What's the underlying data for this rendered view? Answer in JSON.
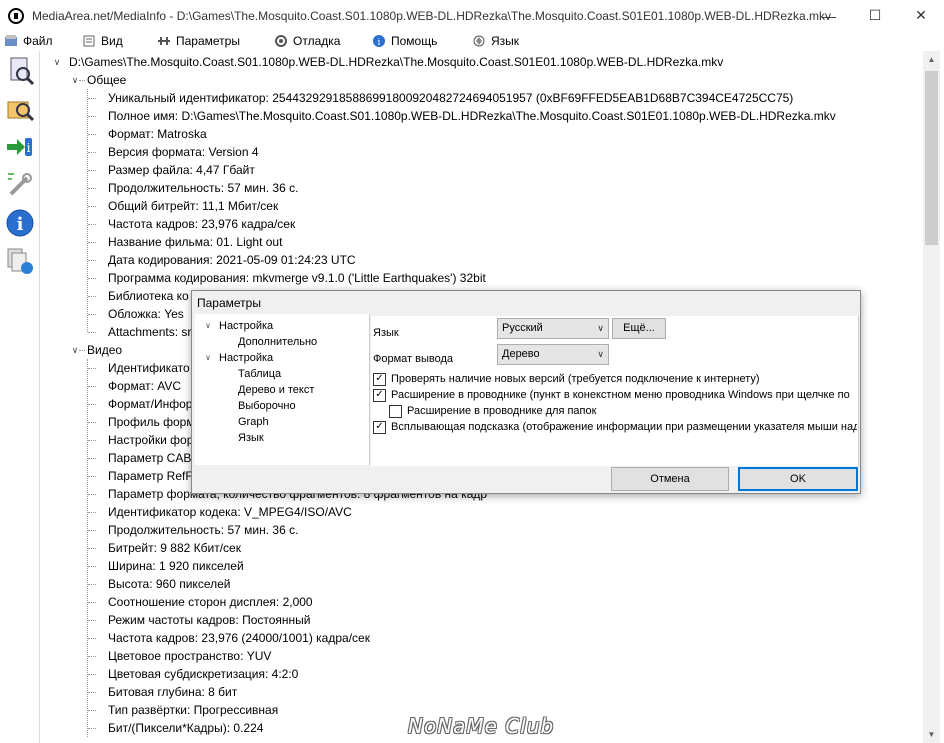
{
  "window": {
    "title": "MediaArea.net/MediaInfo - D:\\Games\\The.Mosquito.Coast.S01.1080p.WEB-DL.HDRezka\\The.Mosquito.Coast.S01E01.1080p.WEB-DL.HDRezka.mkv",
    "minimize": "—",
    "maximize": "☐",
    "close": "✕"
  },
  "menu": {
    "file": "Файл",
    "view": "Вид",
    "params": "Параметры",
    "debug": "Отладка",
    "help": "Помощь",
    "language": "Язык"
  },
  "tree": {
    "root": "D:\\Games\\The.Mosquito.Coast.S01.1080p.WEB-DL.HDRezka\\The.Mosquito.Coast.S01E01.1080p.WEB-DL.HDRezka.mkv",
    "general_header": "Общее",
    "general": [
      "Уникальный идентификатор: 254432929185886991800920482724694051957 (0xBF69FFED5EAB1D68B7C394CE4725CC75)",
      "Полное имя: D:\\Games\\The.Mosquito.Coast.S01.1080p.WEB-DL.HDRezka\\The.Mosquito.Coast.S01E01.1080p.WEB-DL.HDRezka.mkv",
      "Формат: Matroska",
      "Версия формата: Version 4",
      "Размер файла: 4,47 Гбайт",
      "Продолжительность: 57 мин. 36 с.",
      "Общий битрейт: 11,1 Мбит/сек",
      "Частота кадров: 23,976 кадра/сек",
      "Название фильма: 01. Light out",
      "Дата кодирования: 2021-05-09 01:24:23 UTC",
      "Программа кодирования: mkvmerge v9.1.0 ('Little Earthquakes') 32bit",
      "Библиотека ко",
      "Обложка: Yes",
      "Attachments: sr"
    ],
    "video_header": "Видео",
    "video": [
      "Идентификато",
      "Формат: AVC",
      "Формат/Инфор",
      "Профиль форм",
      "Настройки фор",
      "Параметр CAB",
      "Параметр RefF",
      "Параметр формата, количество фрагментов: 8 фрагментов на кадр",
      "Идентификатор кодека: V_MPEG4/ISO/AVC",
      "Продолжительность: 57 мин. 36 с.",
      "Битрейт: 9 882 Кбит/сек",
      "Ширина: 1 920 пикселей",
      "Высота: 960 пикселей",
      "Соотношение сторон дисплея: 2,000",
      "Режим частоты кадров: Постоянный",
      "Частота кадров: 23,976 (24000/1001) кадра/сек",
      "Цветовое пространство: YUV",
      "Цветовая субдискретизация: 4:2:0",
      "Битовая глубина: 8 бит",
      "Тип развёртки: Прогрессивная",
      "Бит/(Пиксели*Кадры): 0.224"
    ]
  },
  "dialog": {
    "title": "Параметры",
    "tree": {
      "setup1": "Настройка",
      "advanced": "Дополнительно",
      "setup2": "Настройка",
      "table": "Таблица",
      "tree_text": "Дерево и текст",
      "selective": "Выборочно",
      "graph": "Graph",
      "language": "Язык"
    },
    "language_label": "Язык",
    "language_value": "Русский",
    "more_button": "Ещё...",
    "output_label": "Формат вывода",
    "output_value": "Дерево",
    "checkboxes": [
      {
        "label": "Проверять наличие новых версий (требуется подключение к интернету)",
        "checked": true
      },
      {
        "label": "Расширение в проводнике (пункт в конекстном меню проводника Windows при щелчке по",
        "checked": true
      },
      {
        "label": "Расширение в проводнике для папок",
        "checked": false
      },
      {
        "label": "Всплывающая подсказка (отображение информации при размещении указателя мыши над",
        "checked": true
      }
    ],
    "cancel": "Отмена",
    "ok": "OK"
  },
  "watermark": "NoNaMe Club"
}
